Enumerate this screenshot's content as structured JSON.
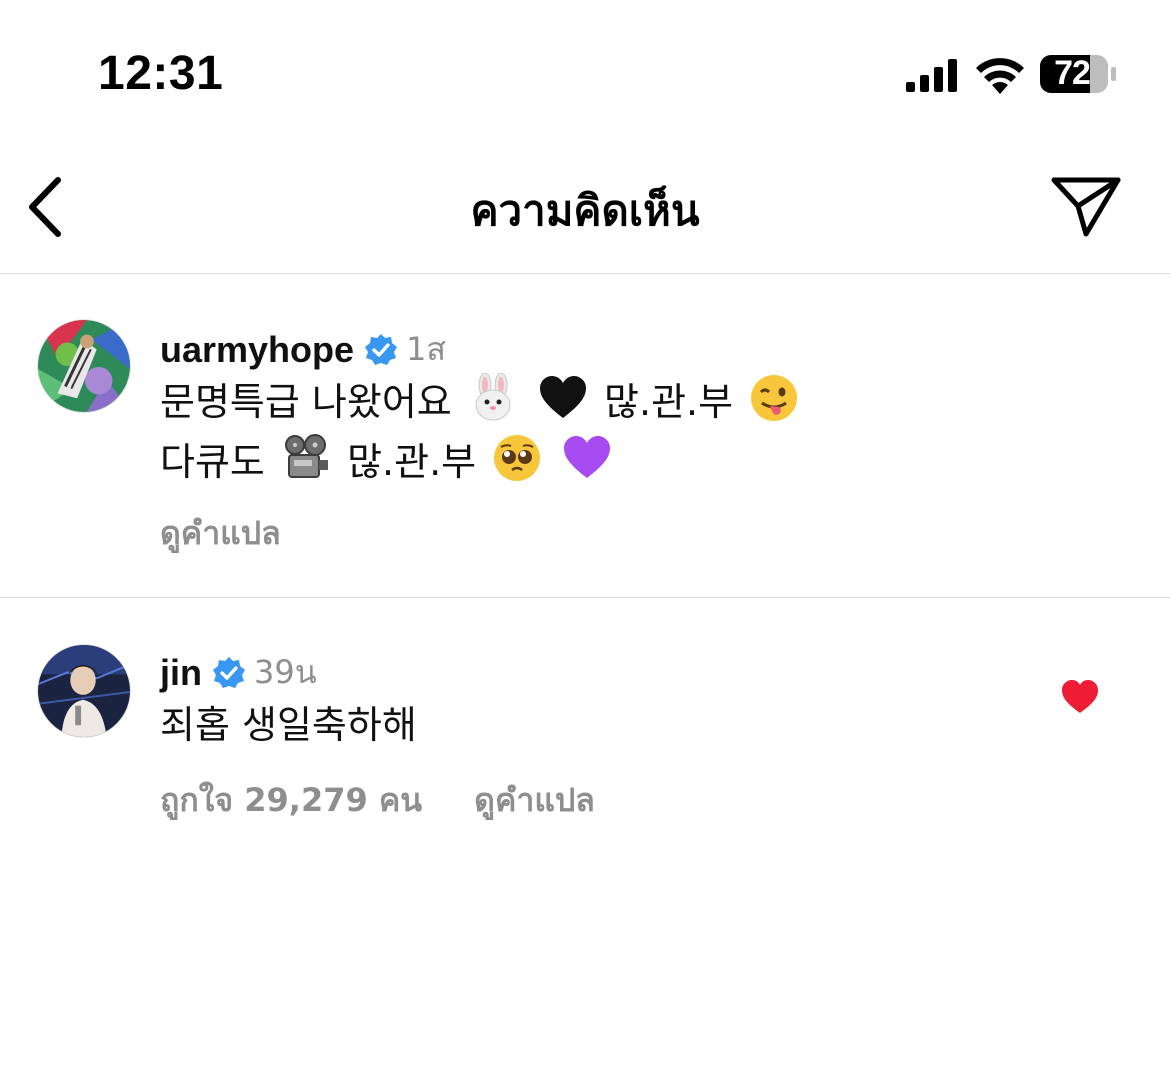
{
  "status_bar": {
    "time": "12:31",
    "battery_percent": "72",
    "signal_icon": "cellular-signal-icon",
    "wifi_icon": "wifi-icon"
  },
  "header": {
    "title": "ความคิดเห็น",
    "back_icon": "chevron-left-icon",
    "share_icon": "paper-plane-icon"
  },
  "comments": [
    {
      "username": "uarmyhope",
      "verified": true,
      "age": "1ส",
      "lines": [
        [
          "문명특급 나왔어요 ",
          "rabbit-face-emoji",
          "black-heart-emoji",
          " 많.관.부",
          "winking-tongue-emoji"
        ],
        [
          "다큐도 ",
          "film-projector-emoji",
          "  많.관.부 ",
          "pleading-face-emoji",
          "purple-heart-emoji"
        ]
      ],
      "line1_text_a": "문명특급 나왔어요",
      "line1_text_b": "많.관.부",
      "line2_text_a": "다큐도",
      "line2_text_b": "많.관.부",
      "translate": "ดูคำแปล"
    },
    {
      "username": "jin",
      "verified": true,
      "age": "39น",
      "text": "죄홉 생일축하해",
      "likes": "ถูกใจ 29,279 คน",
      "translate": "ดูคำแปล",
      "liked": true
    }
  ],
  "colors": {
    "verified_blue": "#3897f0",
    "like_red": "#ed1d35",
    "secondary_text": "#8e8e8e",
    "divider": "#dcdcdc"
  }
}
